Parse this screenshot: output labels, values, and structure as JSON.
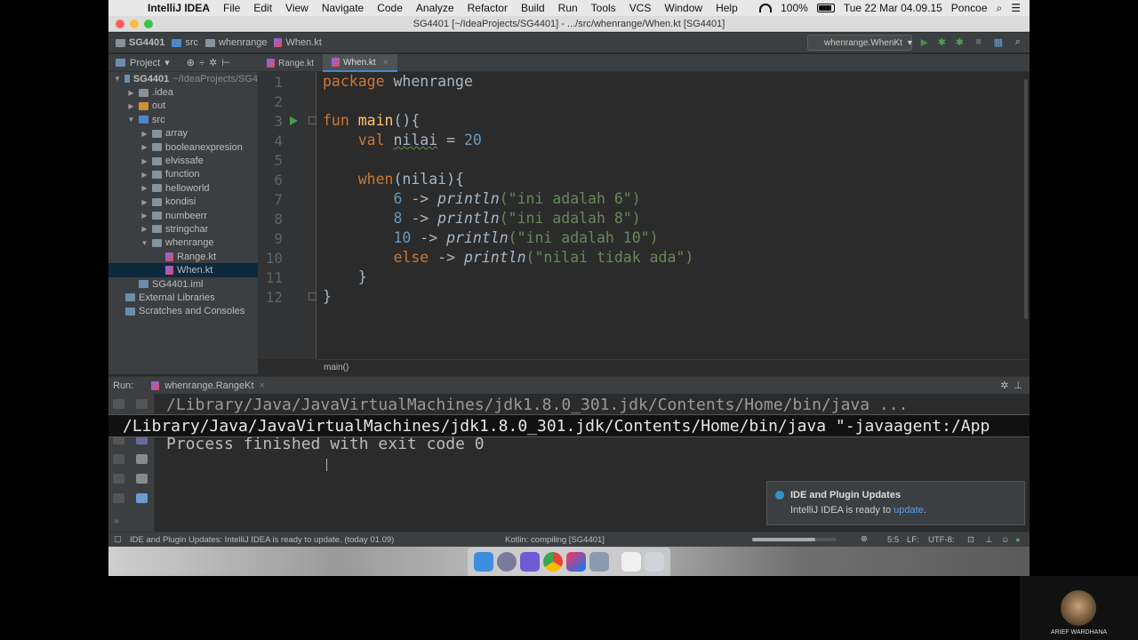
{
  "menubar": {
    "items": [
      "IntelliJ IDEA",
      "File",
      "Edit",
      "View",
      "Navigate",
      "Code",
      "Analyze",
      "Refactor",
      "Build",
      "Run",
      "Tools",
      "VCS",
      "Window",
      "Help"
    ],
    "battery": "100%",
    "clock": "Tue 22 Mar  04.09.15",
    "user": "Poncoe"
  },
  "window": {
    "title": "SG4401 [~/IdeaProjects/SG4401] - .../src/whenrange/When.kt [SG4401]"
  },
  "navbar": {
    "crumbs": [
      "SG4401",
      "src",
      "whenrange",
      "When.kt"
    ],
    "run_config": "whenrange.WhenKt"
  },
  "project": {
    "header": "Project",
    "tree": [
      {
        "label": "SG4401",
        "sub": "~/IdeaProjects/SG4",
        "depth": 0,
        "arrow": "▼",
        "icon": "module"
      },
      {
        "label": ".idea",
        "depth": 1,
        "arrow": "▶",
        "icon": "folder"
      },
      {
        "label": "out",
        "depth": 1,
        "arrow": "▶",
        "icon": "orange"
      },
      {
        "label": "src",
        "depth": 1,
        "arrow": "▼",
        "icon": "blue"
      },
      {
        "label": "array",
        "depth": 2,
        "arrow": "▶",
        "icon": "folder"
      },
      {
        "label": "booleanexpresion",
        "depth": 2,
        "arrow": "▶",
        "icon": "folder"
      },
      {
        "label": "elvissafe",
        "depth": 2,
        "arrow": "▶",
        "icon": "folder"
      },
      {
        "label": "function",
        "depth": 2,
        "arrow": "▶",
        "icon": "folder"
      },
      {
        "label": "helloworld",
        "depth": 2,
        "arrow": "▶",
        "icon": "folder"
      },
      {
        "label": "kondisi",
        "depth": 2,
        "arrow": "▶",
        "icon": "folder"
      },
      {
        "label": "numbeerr",
        "depth": 2,
        "arrow": "▶",
        "icon": "folder"
      },
      {
        "label": "stringchar",
        "depth": 2,
        "arrow": "▶",
        "icon": "folder"
      },
      {
        "label": "whenrange",
        "depth": 2,
        "arrow": "▼",
        "icon": "folder"
      },
      {
        "label": "Range.kt",
        "depth": 3,
        "arrow": "",
        "icon": "kotlin"
      },
      {
        "label": "When.kt",
        "depth": 3,
        "arrow": "",
        "icon": "kotlin",
        "selected": true
      },
      {
        "label": "SG4401.iml",
        "depth": 1,
        "arrow": "",
        "icon": "module"
      },
      {
        "label": "External Libraries",
        "depth": 0,
        "arrow": "",
        "icon": "lib"
      },
      {
        "label": "Scratches and Consoles",
        "depth": 0,
        "arrow": "",
        "icon": "lib"
      }
    ]
  },
  "editor": {
    "tabs": [
      {
        "label": "Range.kt",
        "active": false
      },
      {
        "label": "When.kt",
        "active": true
      }
    ],
    "line_numbers": [
      "1",
      "2",
      "3",
      "4",
      "5",
      "6",
      "7",
      "8",
      "9",
      "10",
      "11",
      "12"
    ],
    "code": {
      "l1_kw": "package",
      "l1_rest": " whenrange",
      "l3_kw": "fun",
      "l3_fn": "main",
      "l3_rest": "(){",
      "l4_kw": "val",
      "l4_var": "nilai",
      "l4_op": " = ",
      "l4_num": "20",
      "l6_kw": "when",
      "l6_rest": "(nilai){",
      "l7_num": "6",
      "l7_arrow": " -> ",
      "l7_fn": "println",
      "l7_str": "(\"ini adalah 6\")",
      "l8_num": "8",
      "l8_arrow": " -> ",
      "l8_fn": "println",
      "l8_str": "(\"ini adalah 8\")",
      "l9_num": "10",
      "l9_arrow": " -> ",
      "l9_fn": "println",
      "l9_str": "(\"ini adalah 10\")",
      "l10_kw": "else",
      "l10_arrow": " -> ",
      "l10_fn": "println",
      "l10_str": "(\"nilai tidak ada\")",
      "l11": "}",
      "l12": "}"
    },
    "breadcrumb": "main()"
  },
  "run": {
    "label": "Run:",
    "tab": "whenrange.RangeKt",
    "console_line1": "/Library/Java/JavaVirtualMachines/jdk1.8.0_301.jdk/Contents/Home/bin/java ...",
    "tooltip": "/Library/Java/JavaVirtualMachines/jdk1.8.0_301.jdk/Contents/Home/bin/java \"-javaagent:/App",
    "console_line3": "Process finished with exit code 0"
  },
  "notification": {
    "title": "IDE and Plugin Updates",
    "body": "IntelliJ IDEA is ready to ",
    "link": "update",
    "end": "."
  },
  "statusbar": {
    "message": "IDE and Plugin Updates: IntelliJ IDEA is ready to update. (today 01.09)",
    "task": "Kotlin: compiling [SG4401]",
    "progress": 0.75,
    "position": "5:5",
    "line_sep": "LF:",
    "encoding": "UTF-8:"
  },
  "webcam": {
    "name": "ARIEF WARDHANA"
  }
}
